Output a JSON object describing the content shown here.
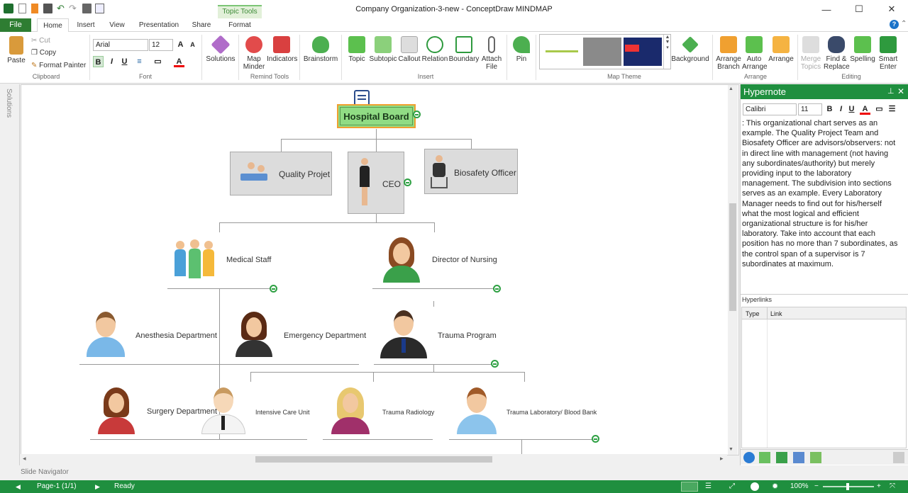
{
  "window": {
    "title": "Company  Organization-3-new - ConceptDraw MINDMAP",
    "contextual_tab": "Topic Tools"
  },
  "tabs": {
    "file": "File",
    "items": [
      "Home",
      "Insert",
      "View",
      "Presentation",
      "Share",
      "Format"
    ],
    "active": "Home"
  },
  "ribbon": {
    "clipboard": {
      "paste": "Paste",
      "cut": "Cut",
      "copy": "Copy",
      "format_painter": "Format Painter",
      "label": "Clipboard"
    },
    "font": {
      "family": "Arial",
      "size": "12",
      "label": "Font"
    },
    "solutions": {
      "label": "Solutions"
    },
    "remind": {
      "map_minder_1": "Map",
      "map_minder_2": "Minder",
      "indicators": "Indicators",
      "label": "Remind Tools"
    },
    "brainstorm": "Brainstorm",
    "insert": {
      "topic": "Topic",
      "subtopic": "Subtopic",
      "callout": "Callout",
      "relation": "Relation",
      "boundary": "Boundary",
      "attach_1": "Attach",
      "attach_2": "File",
      "label": "Insert"
    },
    "pin": "Pin",
    "map_theme": {
      "label": "Map Theme",
      "background": "Background"
    },
    "arrange": {
      "arrange_branch_1": "Arrange",
      "arrange_branch_2": "Branch",
      "auto_arrange_1": "Auto",
      "auto_arrange_2": "Arrange",
      "arrange": "Arrange",
      "label": "Arrange"
    },
    "editing": {
      "merge_1": "Merge",
      "merge_2": "Topics",
      "find_1": "Find &",
      "find_2": "Replace",
      "spelling": "Spelling",
      "smart_1": "Smart",
      "smart_2": "Enter",
      "label": "Editing"
    }
  },
  "left_strip": {
    "label": "Solutions"
  },
  "map": {
    "root": "Hospital Board",
    "quality": "Quality Projet",
    "ceo": "CEO",
    "biosafety": "Biosafety Officer",
    "medical_staff": "Medical Staff",
    "director_nursing": "Director of Nursing",
    "anesthesia": "Anesthesia Department",
    "emergency": "Emergency Department",
    "trauma_program": "Trauma Program",
    "surgery": "Surgery Department",
    "icu": "Intensive Care Unit",
    "trauma_radiology": "Trauma Radiology",
    "trauma_lab": "Trauma Laboratory/ Blood Bank"
  },
  "hypernote": {
    "title": "Hypernote",
    "font_family": "Calibri",
    "font_size": "11",
    "text": ": This organizational chart serves as an example. The Quality Project Team and Biosafety Officer are advisors/observers: not in direct line with management (not having any subordinates/authority) but merely providing input to the laboratory management. The subdivision into sections serves as an example. Every Laboratory Manager needs to find out for his/herself what the most logical and efficient organizational structure is for his/her laboratory. Take into account that each position has no more than 7 subordinates, as the control span of a supervisor is 7 subordinates at maximum.",
    "hyperlinks_label": "Hyperlinks",
    "col_type": "Type",
    "col_link": "Link"
  },
  "slide_navigator": "Slide Navigator",
  "status": {
    "page": "Page-1 (1/1)",
    "state": "Ready",
    "zoom": "100%"
  },
  "colors": {
    "accent_green": "#1f8f3f",
    "root_fill": "#90dc84",
    "root_border": "#f0a030"
  }
}
